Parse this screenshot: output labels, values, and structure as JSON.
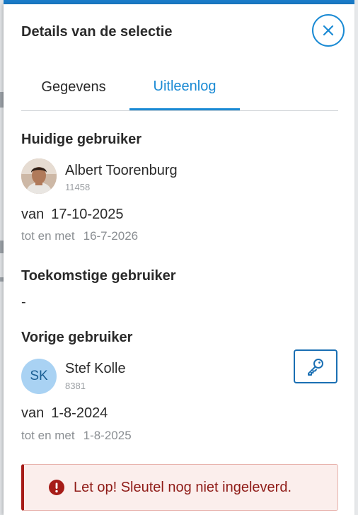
{
  "panel": {
    "title": "Details van de selectie",
    "close_icon": "close-icon"
  },
  "tabs": [
    {
      "label": "Gegevens",
      "active": false
    },
    {
      "label": "Uitleenlog",
      "active": true
    }
  ],
  "current_user": {
    "heading": "Huidige gebruiker",
    "name": "Albert Toorenburg",
    "id": "11458",
    "avatar": "user-photo",
    "from_label": "van",
    "from_date": "17-10-2025",
    "until_label": "tot en met",
    "until_date": "16-7-2026"
  },
  "future_user": {
    "heading": "Toekomstige gebruiker",
    "value": "-"
  },
  "previous_user": {
    "heading": "Vorige gebruiker",
    "initials": "SK",
    "name": "Stef Kolle",
    "id": "8381",
    "from_label": "van",
    "from_date": "1-8-2024",
    "until_label": "tot en met",
    "until_date": "1-8-2025",
    "key_icon": "key-icon"
  },
  "alert": {
    "icon": "exclamation-circle-icon",
    "text": "Let op! Sleutel nog niet ingeleverd."
  },
  "colors": {
    "accent": "#1a8ad4",
    "alert_text": "#8f1b17",
    "alert_border": "#a61c18",
    "alert_bg": "#fbeeec",
    "avatar_initials_bg": "#a9d2f3"
  }
}
